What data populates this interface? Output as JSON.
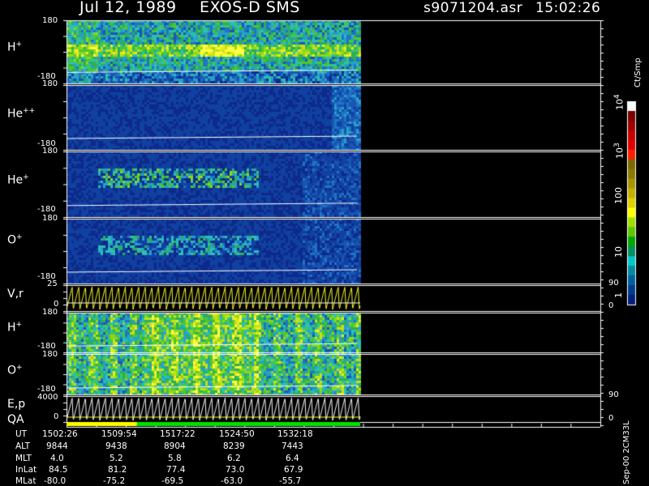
{
  "header": {
    "date": "Jul 12, 1989",
    "instrument": "EXOS-D SMS",
    "file": "s9071204.asr",
    "time": "15:02:26"
  },
  "panels": [
    {
      "species": "H",
      "charge": "+",
      "ymax": "180",
      "ymin": "-180"
    },
    {
      "species": "He",
      "charge": "++",
      "ymax": "180",
      "ymin": "-180"
    },
    {
      "species": "He",
      "charge": "+",
      "ymax": "180",
      "ymin": "-180"
    },
    {
      "species": "O",
      "charge": "+",
      "ymax": "180",
      "ymin": "-180"
    },
    {
      "species": "V,r",
      "charge": "",
      "ymax": "25",
      "ymin": "0",
      "right_top": "90",
      "right_bottom": "0"
    },
    {
      "species": "H",
      "charge": "+",
      "ymax": "180",
      "ymin": "-180"
    },
    {
      "species": "O",
      "charge": "+",
      "ymax": "180",
      "ymin": "-180"
    },
    {
      "species": "E,p",
      "charge": "",
      "ymax": "4000",
      "ymin": "0",
      "right_top": "90",
      "right_bottom": "0"
    }
  ],
  "qa_label": "QA",
  "colorbar": {
    "unit": "Ct/Smp",
    "labels": [
      "10^4",
      "10^3",
      "100",
      "10",
      "1"
    ],
    "colors": [
      "#ffffff",
      "#7a0000",
      "#a00000",
      "#c80000",
      "#e00000",
      "#ff2000",
      "#7a6a00",
      "#8c7a00",
      "#a89400",
      "#c4b000",
      "#e0d000",
      "#ffff00",
      "#a0e000",
      "#60c800",
      "#00a800",
      "#009060",
      "#00c8c8",
      "#008ca0",
      "#0060a0",
      "#003c90",
      "#00207a"
    ]
  },
  "footer": {
    "rows": [
      {
        "label": "UT",
        "values": [
          "1502:26",
          "1509:54",
          "1517:22",
          "1524:50",
          "1532:18"
        ]
      },
      {
        "label": "ALT",
        "values": [
          "9844",
          "9438",
          "8904",
          "8239",
          "7443"
        ]
      },
      {
        "label": "MLT",
        "values": [
          "4.0",
          "5.2",
          "5.8",
          "6.2",
          "6.4"
        ]
      },
      {
        "label": "InLat",
        "values": [
          "84.5",
          "81.2",
          "77.4",
          "73.0",
          "67.9"
        ]
      },
      {
        "label": "MLat",
        "values": [
          "-80.0",
          "-75.2",
          "-69.5",
          "-63.0",
          "-55.7"
        ]
      }
    ],
    "version": "Sep-00 2CM33L"
  },
  "chart_data": {
    "type": "heatmap",
    "title": "EXOS-D SMS",
    "x_ticks_ut": [
      "1502:26",
      "1509:54",
      "1517:22",
      "1524:50",
      "1532:18"
    ],
    "data_end_fraction": 0.5,
    "panels": [
      {
        "name": "H+",
        "ylim": [
          -180,
          180
        ],
        "peak_level": 12
      },
      {
        "name": "He++",
        "ylim": [
          -180,
          180
        ],
        "peak_level": 3
      },
      {
        "name": "He+",
        "ylim": [
          -180,
          180
        ],
        "peak_level": 8
      },
      {
        "name": "O+",
        "ylim": [
          -180,
          180
        ],
        "peak_level": 6
      },
      {
        "name": "V,r",
        "ylim": [
          0,
          25
        ],
        "type": "line"
      },
      {
        "name": "H+",
        "ylim": [
          -180,
          180
        ],
        "peak_level": 12
      },
      {
        "name": "O+",
        "ylim": [
          -180,
          180
        ],
        "peak_level": 9
      },
      {
        "name": "E,p",
        "ylim": [
          0,
          4000
        ],
        "type": "line"
      }
    ],
    "qa": [
      {
        "from": 0.0,
        "to": 0.24,
        "color": "#ffff00"
      },
      {
        "from": 0.24,
        "to": 1.0,
        "color": "#00e000"
      }
    ],
    "colorbar_range": [
      1,
      10000
    ],
    "colorbar_scale": "log"
  }
}
